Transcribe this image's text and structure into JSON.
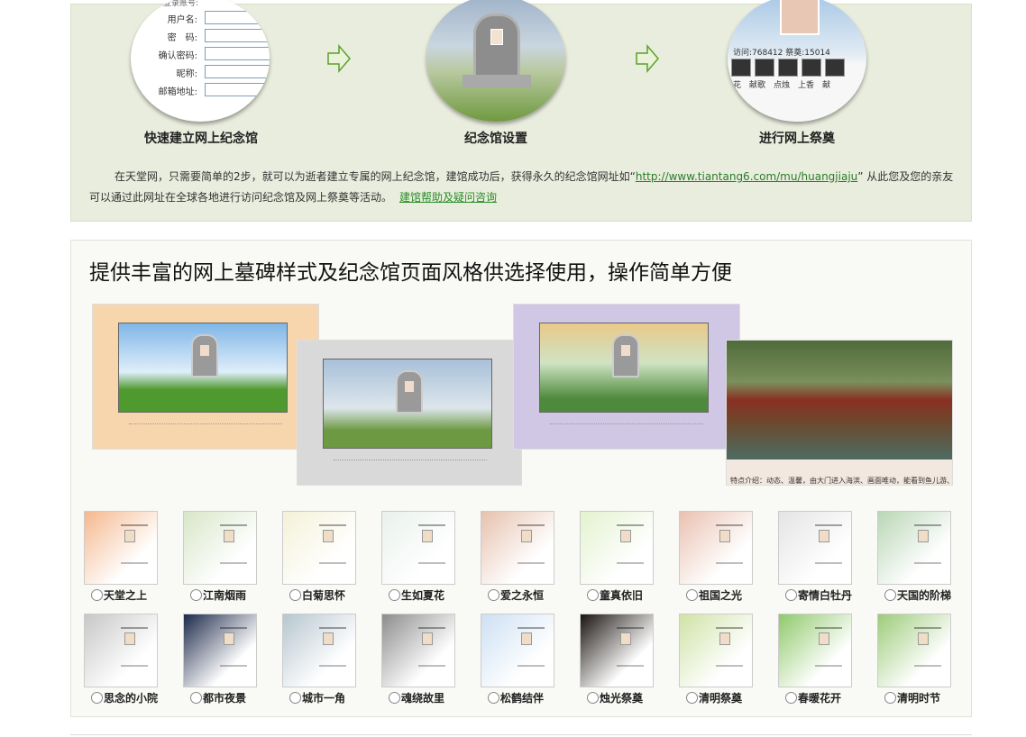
{
  "steps": {
    "step1": {
      "title": "快速建立网上纪念馆",
      "form_header": "设置登录账号:",
      "fields": [
        "用户名:",
        "密　码:",
        "确认密码:",
        "昵称:",
        "邮箱地址:"
      ]
    },
    "step2": {
      "title": "纪念馆设置"
    },
    "step3": {
      "title": "进行网上祭奠",
      "stats": "访问:768412  祭奠:15014",
      "actions": [
        "花",
        "献歌",
        "点烛",
        "上香",
        "献"
      ]
    },
    "arrow_icon": "right-arrow-icon",
    "description_text": "在天堂网，只需要简单的2步，就可以为逝者建立专属的网上纪念馆，建馆成功后，获得永久的纪念馆网址如“",
    "description_url": "http://www.tiantang6.com/mu/huangjiaju",
    "description_tail": "” 从此您及您的亲友可以通过此网址在全球各地进行访问纪念馆及网上祭奠等活动。",
    "help_link": "建馆帮助及疑问咨询"
  },
  "styles": {
    "title": "提供丰富的网上墓碑样式及纪念馆页面风格供选择使用，操作简单方便",
    "preview_caption": "特点介绍：动态、温馨，由大门进入海滨、画面唯动，能看到鱼儿游、鸟儿飞......",
    "row1": [
      {
        "label": "天堂之上",
        "color": "#f5b88e"
      },
      {
        "label": "江南烟雨",
        "color": "#d7e6c8"
      },
      {
        "label": "白菊思怀",
        "color": "#f4f1d8"
      },
      {
        "label": "生如夏花",
        "color": "#e9f1ec"
      },
      {
        "label": "爱之永恒",
        "color": "#e6c1ad"
      },
      {
        "label": "童真依旧",
        "color": "#e3f2cf"
      },
      {
        "label": "祖国之光",
        "color": "#e9c1b1"
      },
      {
        "label": "寄情白牡丹",
        "color": "#e4e4e4"
      },
      {
        "label": "天国的阶梯",
        "color": "#b9d6b6"
      }
    ],
    "row2": [
      {
        "label": "思念的小院",
        "color": "#c7c7c7"
      },
      {
        "label": "都市夜景",
        "color": "#1c2a4a"
      },
      {
        "label": "城市一角",
        "color": "#b6c6cf"
      },
      {
        "label": "魂绕故里",
        "color": "#8c8c8c"
      },
      {
        "label": "松鹤结伴",
        "color": "#cde0f3"
      },
      {
        "label": "烛光祭奠",
        "color": "#1a1410"
      },
      {
        "label": "清明祭奠",
        "color": "#cfe2a6"
      },
      {
        "label": "春暖花开",
        "color": "#8fc96a"
      },
      {
        "label": "清明时节",
        "color": "#9ccb7a"
      }
    ]
  }
}
